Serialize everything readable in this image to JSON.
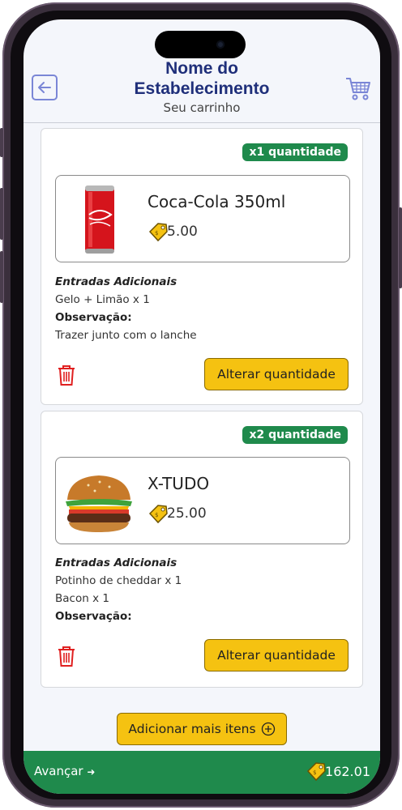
{
  "header": {
    "title_line1": "Nome do",
    "title_line2": "Estabelecimento",
    "subtitle": "Seu carrinho"
  },
  "items": [
    {
      "quantity_badge": "x1 quantidade",
      "name": "Coca-Cola 350ml",
      "price": "5.00",
      "extras_heading": "Entradas Adicionais",
      "extras": [
        "Gelo + Limão x 1"
      ],
      "observation_label": "Observação:",
      "observation": "Trazer junto com o lanche",
      "alter_label": "Alterar quantidade",
      "image_icon": "soda-can-image"
    },
    {
      "quantity_badge": "x2 quantidade",
      "name": "X-TUDO",
      "price": "25.00",
      "extras_heading": "Entradas Adicionais",
      "extras": [
        "Potinho de cheddar x 1",
        "Bacon x 1"
      ],
      "observation_label": "Observação:",
      "observation": "",
      "alter_label": "Alterar quantidade",
      "image_icon": "burger-image"
    }
  ],
  "add_more_label": "Adicionar mais itens",
  "footer": {
    "advance_label": "Avançar",
    "total": "162.01"
  },
  "colors": {
    "primary_green": "#1f8a4c",
    "button_yellow": "#f5c211",
    "title_blue": "#1f2f7a",
    "trash_red": "#e02020"
  }
}
